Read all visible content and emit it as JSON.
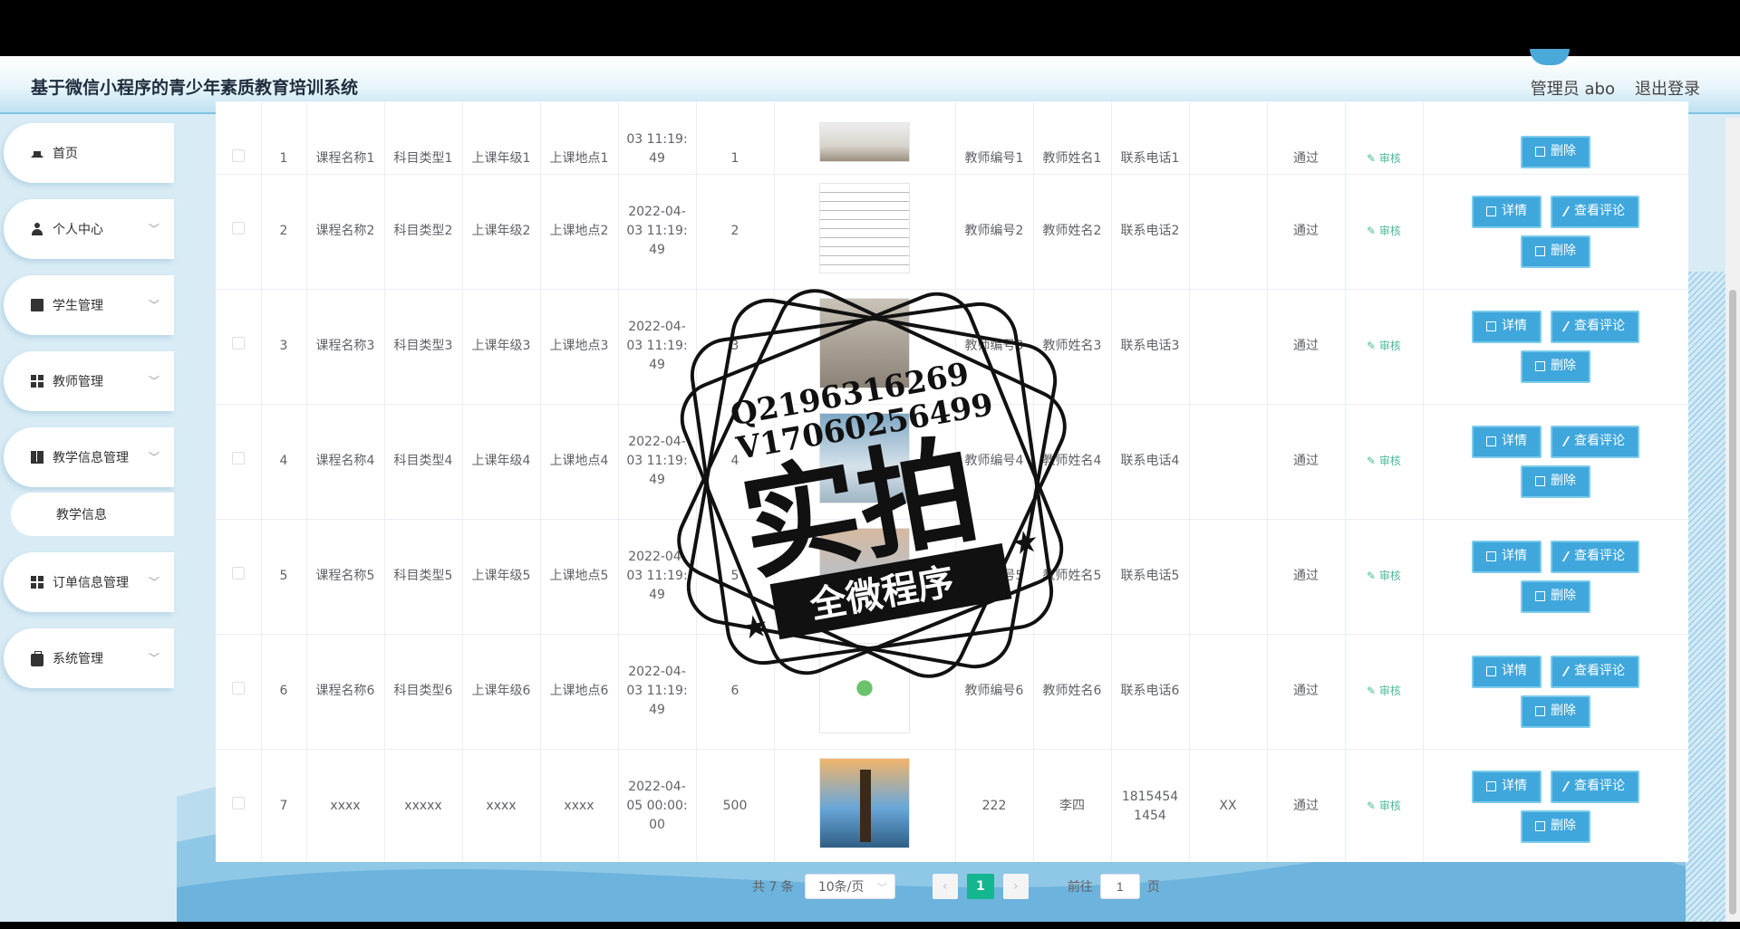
{
  "header": {
    "title": "基于微信小程序的青少年素质教育培训系统",
    "admin": "管理员 abo",
    "logout": "退出登录"
  },
  "sidebar": {
    "items": [
      {
        "label": "首页"
      },
      {
        "label": "个人中心"
      },
      {
        "label": "学生管理"
      },
      {
        "label": "教师管理"
      },
      {
        "label": "教学信息管理"
      },
      {
        "label": "教学信息"
      },
      {
        "label": "订单信息管理"
      },
      {
        "label": "系统管理"
      }
    ]
  },
  "table": {
    "audit_label": "审核",
    "buttons": {
      "detail": "详情",
      "comment": "查看评论",
      "delete": "删除"
    },
    "partial_row": {
      "index": "1",
      "course": "课程名称1",
      "subject": "科目类型1",
      "grade": "上课年级1",
      "place": "上课地点1",
      "time_partial": "03 11:19:\n49",
      "count": "1",
      "teacher_no": "教师编号1",
      "teacher_name": "教师姓名1",
      "phone": "联系电话1",
      "remark": "",
      "status": "通过"
    },
    "rows": [
      {
        "index": "2",
        "course": "课程名称2",
        "subject": "科目类型2",
        "grade": "上课年级2",
        "place": "上课地点2",
        "time": "2022-04-\n03 11:19:\n49",
        "count": "2",
        "teacher_no": "教师编号2",
        "teacher_name": "教师姓名2",
        "phone": "联系电话2",
        "remark": "",
        "status": "通过"
      },
      {
        "index": "3",
        "course": "课程名称3",
        "subject": "科目类型3",
        "grade": "上课年级3",
        "place": "上课地点3",
        "time": "2022-04-\n03 11:19:\n49",
        "count": "3",
        "teacher_no": "教师编号3",
        "teacher_name": "教师姓名3",
        "phone": "联系电话3",
        "remark": "",
        "status": "通过"
      },
      {
        "index": "4",
        "course": "课程名称4",
        "subject": "科目类型4",
        "grade": "上课年级4",
        "place": "上课地点4",
        "time": "2022-04-\n03 11:19:\n49",
        "count": "4",
        "teacher_no": "教师编号4",
        "teacher_name": "教师姓名4",
        "phone": "联系电话4",
        "remark": "",
        "status": "通过"
      },
      {
        "index": "5",
        "course": "课程名称5",
        "subject": "科目类型5",
        "grade": "上课年级5",
        "place": "上课地点5",
        "time": "2022-04-\n03 11:19:\n49",
        "count": "5",
        "teacher_no": "教师编号5",
        "teacher_name": "教师姓名5",
        "phone": "联系电话5",
        "remark": "",
        "status": "通过"
      },
      {
        "index": "6",
        "course": "课程名称6",
        "subject": "科目类型6",
        "grade": "上课年级6",
        "place": "上课地点6",
        "time": "2022-04-\n03 11:19:\n49",
        "count": "6",
        "teacher_no": "教师编号6",
        "teacher_name": "教师姓名6",
        "phone": "联系电话6",
        "remark": "",
        "status": "通过"
      },
      {
        "index": "7",
        "course": "xxxx",
        "subject": "xxxxx",
        "grade": "xxxx",
        "place": "xxxx",
        "time": "2022-04-\n05 00:00:\n00",
        "count": "500",
        "teacher_no": "222",
        "teacher_name": "李四",
        "phone": "1815454\n1454",
        "remark": "XX",
        "status": "通过"
      }
    ]
  },
  "pager": {
    "total": "共 7 条",
    "page_size": "10条/页",
    "current": "1",
    "goto_label": "前往",
    "goto_value": "1",
    "page_unit": "页"
  },
  "watermark": {
    "line1": "Q2196316269",
    "line2": "V17060256499",
    "main": "实拍",
    "banner": "全微程序"
  }
}
